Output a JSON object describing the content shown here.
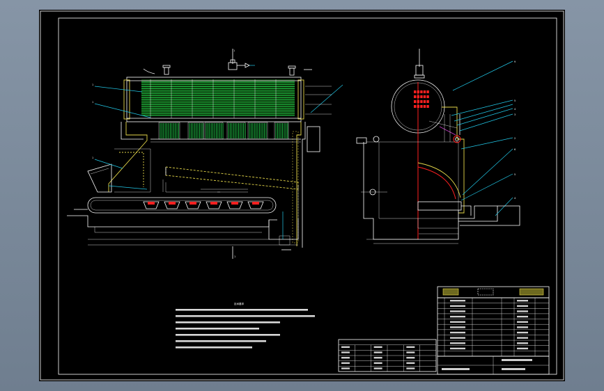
{
  "drawing": {
    "colors": {
      "background": "#000000",
      "outline": "#ffffff",
      "leader": "#21c8e8",
      "tubes": "#21d04a",
      "refractory": "#e6d84a",
      "centerline": "#ff2020",
      "viewport": "#7b8a9a"
    },
    "callouts_left": [
      "1",
      "1",
      "1"
    ],
    "callouts_right": [
      "9",
      "5",
      "4",
      "3",
      "2",
      "6",
      "5",
      "4"
    ],
    "section_mark": "1",
    "notes_title": "技术要求",
    "notes_lines": 7,
    "parts_table": {
      "rows": 10,
      "columns": 5
    },
    "material_table": {
      "rows": 5,
      "columns": 6
    }
  }
}
